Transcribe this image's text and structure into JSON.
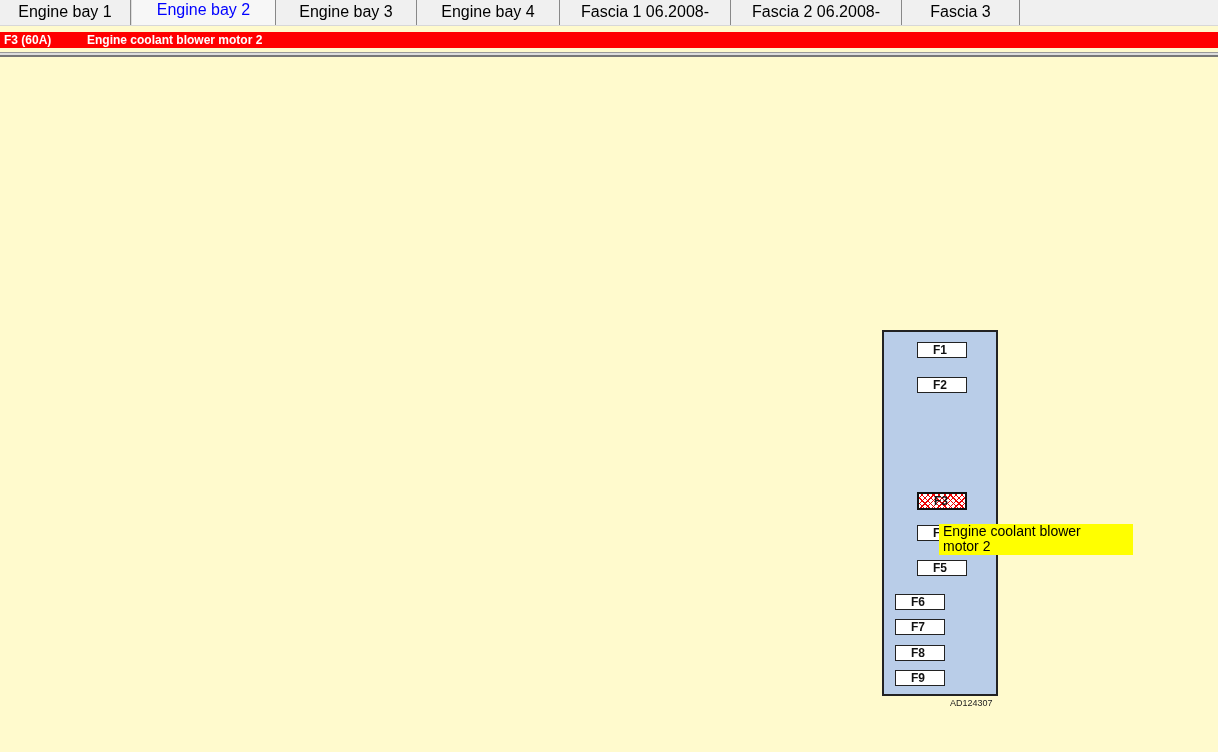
{
  "tabs": [
    {
      "label": "Engine bay 1",
      "selected": false
    },
    {
      "label": "Engine bay 2",
      "selected": true
    },
    {
      "label": "Engine bay 3",
      "selected": false
    },
    {
      "label": "Engine bay 4",
      "selected": false
    },
    {
      "label": "Fascia 1 06.2008-",
      "selected": false
    },
    {
      "label": "Fascia 2 06.2008-",
      "selected": false
    },
    {
      "label": "Fascia 3",
      "selected": false
    }
  ],
  "status": {
    "fuse": "F3 (60A)",
    "description": "Engine coolant blower motor 2"
  },
  "fuse_box": {
    "code": "AD124307",
    "fuses": [
      {
        "label": "F1",
        "selected": false
      },
      {
        "label": "F2",
        "selected": false
      },
      {
        "label": "F3",
        "selected": true
      },
      {
        "label": "F",
        "selected": false
      },
      {
        "label": "F5",
        "selected": false
      },
      {
        "label": "F6",
        "selected": false
      },
      {
        "label": "F7",
        "selected": false
      },
      {
        "label": "F8",
        "selected": false
      },
      {
        "label": "F9",
        "selected": false
      }
    ]
  },
  "tooltip": {
    "text": "Engine coolant blower motor 2"
  }
}
